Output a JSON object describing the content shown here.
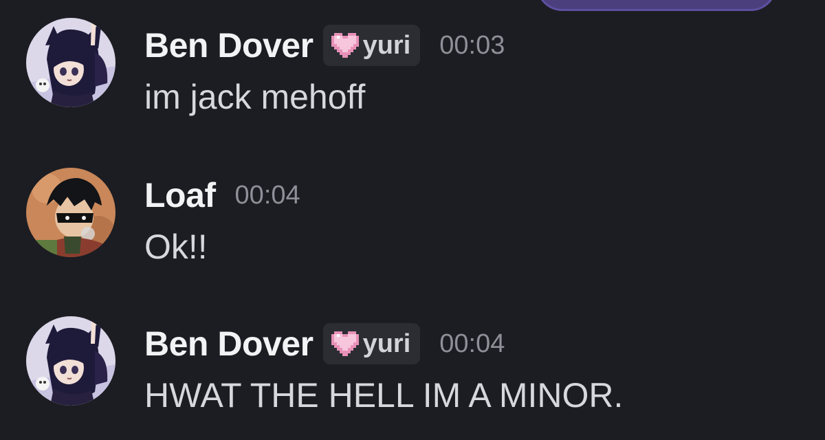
{
  "colors": {
    "background": "#1c1d22",
    "username": "#f2f3f5",
    "message_text": "#d6d8dc",
    "timestamp": "#8e9099",
    "tag_background": "#2b2d33",
    "tag_heart": "#f2b8d6",
    "top_bubble": "#4b3f7e"
  },
  "messages": [
    {
      "avatar": "avatar-cat-girl",
      "username": "Ben Dover",
      "tag": {
        "icon": "pixel-heart-icon",
        "label": "yuri"
      },
      "timestamp": "00:03",
      "text": "im jack mehoff"
    },
    {
      "avatar": "avatar-masked-boy",
      "username": "Loaf",
      "timestamp": "00:04",
      "text": "Ok!!"
    },
    {
      "avatar": "avatar-cat-girl",
      "username": "Ben Dover",
      "tag": {
        "icon": "pixel-heart-icon",
        "label": "yuri"
      },
      "timestamp": "00:04",
      "text": "HWAT THE HELL IM A MINOR."
    }
  ]
}
